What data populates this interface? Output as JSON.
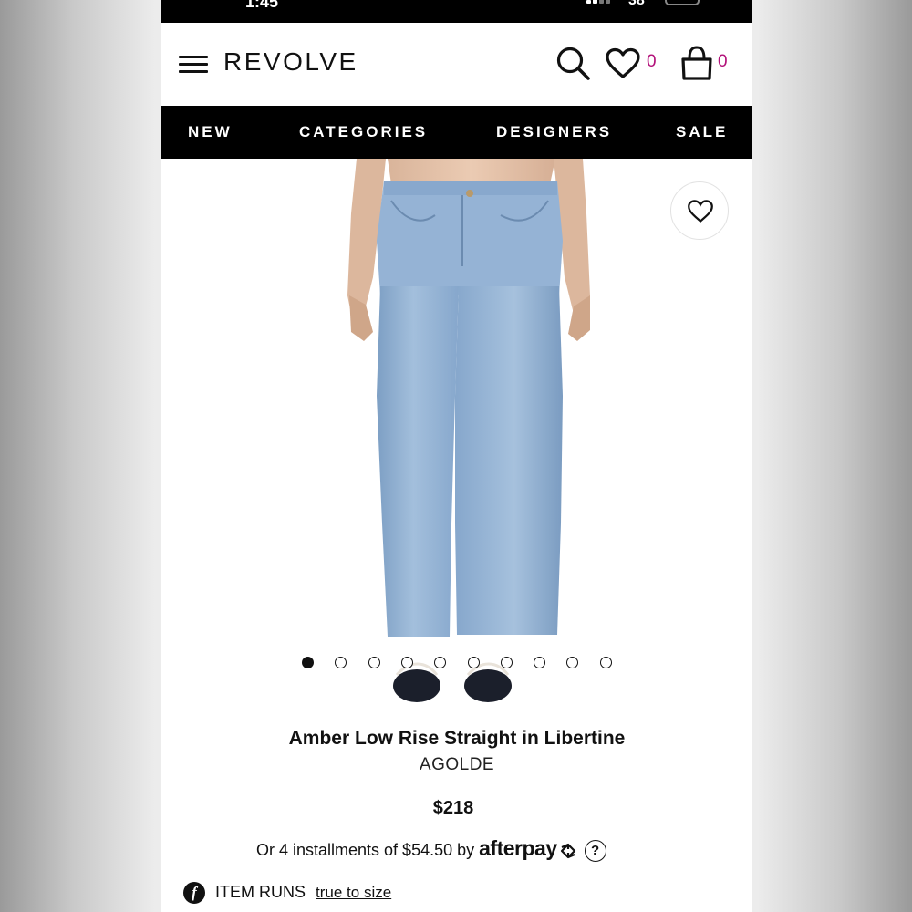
{
  "status_bar": {
    "time": "1:45",
    "battery": "38"
  },
  "header": {
    "brand": "REVOLVE",
    "wishlist_count": "0",
    "cart_count": "0"
  },
  "nav": {
    "items": [
      "NEW",
      "CATEGORIES",
      "DESIGNERS",
      "SALE"
    ]
  },
  "gallery": {
    "image_count": 10,
    "active_index": 0
  },
  "product": {
    "name": "Amber Low Rise Straight in Libertine",
    "designer": "AGOLDE",
    "price": "$218",
    "installments_text": "Or 4 installments of $54.50 by",
    "installments_provider": "afterpay",
    "help_glyph": "?",
    "fit_icon_glyph": "f",
    "fit_label": "ITEM RUNS",
    "fit_value": "true to size"
  },
  "colors": {
    "accent": "#b3127a",
    "nav_bg": "#000000",
    "denim": "#8fb0d4"
  }
}
